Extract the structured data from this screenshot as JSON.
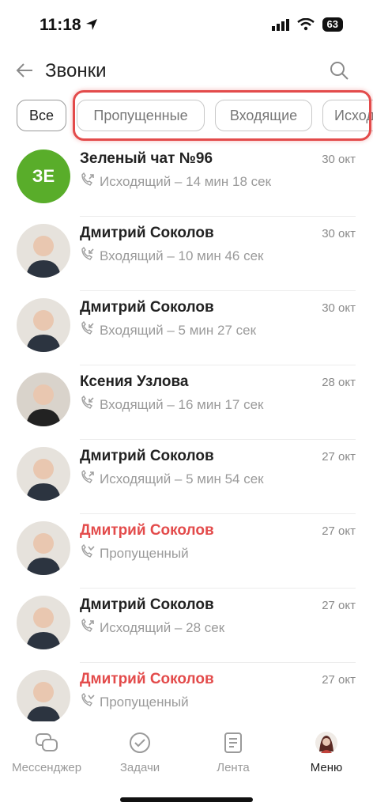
{
  "status_bar": {
    "time": "11:18",
    "battery": "63"
  },
  "header": {
    "title": "Звонки"
  },
  "filters": [
    {
      "label": "Все",
      "active": true
    },
    {
      "label": "Пропущенные",
      "active": false
    },
    {
      "label": "Входящие",
      "active": false
    },
    {
      "label": "Исходящие",
      "active": false
    }
  ],
  "calls": [
    {
      "name": "Зеленый чат №96",
      "initials": "ЗЕ",
      "detail": "Исходящий – 14 мин 18 сек",
      "date": "30 окт",
      "missed": false,
      "type": "outgoing"
    },
    {
      "name": "Дмитрий Соколов",
      "detail": "Входящий – 10 мин 46 сек",
      "date": "30 окт",
      "missed": false,
      "type": "incoming"
    },
    {
      "name": "Дмитрий Соколов",
      "detail": "Входящий – 5 мин 27 сек",
      "date": "30 окт",
      "missed": false,
      "type": "incoming"
    },
    {
      "name": "Ксения Узлова",
      "detail": "Входящий – 16 мин 17 сек",
      "date": "28 окт",
      "missed": false,
      "type": "incoming"
    },
    {
      "name": "Дмитрий Соколов",
      "detail": "Исходящий – 5 мин 54 сек",
      "date": "27 окт",
      "missed": false,
      "type": "outgoing"
    },
    {
      "name": "Дмитрий Соколов",
      "detail": "Пропущенный",
      "date": "27 окт",
      "missed": true,
      "type": "missed"
    },
    {
      "name": "Дмитрий Соколов",
      "detail": "Исходящий – 28 сек",
      "date": "27 окт",
      "missed": false,
      "type": "outgoing"
    },
    {
      "name": "Дмитрий Соколов",
      "detail": "Пропущенный",
      "date": "27 окт",
      "missed": true,
      "type": "missed"
    }
  ],
  "tabbar": {
    "messenger": "Мессенджер",
    "tasks": "Задачи",
    "feed": "Лента",
    "menu": "Меню"
  },
  "colors": {
    "missed": "#e34b4b",
    "green_avatar": "#59ad2a"
  }
}
